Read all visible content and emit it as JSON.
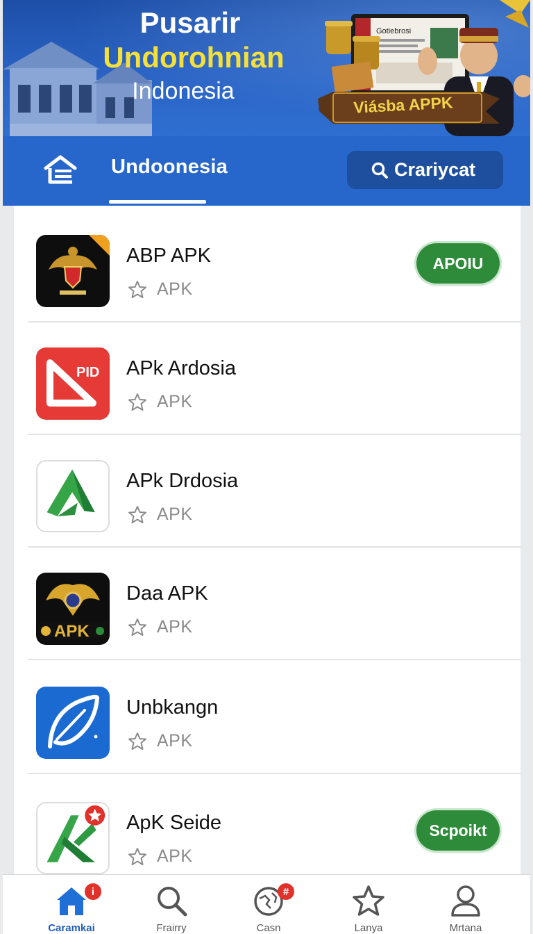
{
  "banner": {
    "title_line1": "Pusarir",
    "title_line2": "Undorohnian",
    "title_line3": "Indonesia",
    "ribbon": "Viásba APPK",
    "screen_text": "Gotiebrosi"
  },
  "nav": {
    "tab_label": "Undoonesia",
    "search_label": "Crariycat"
  },
  "apps": [
    {
      "name": "ABP APK",
      "meta": "APK",
      "action": "APOIU",
      "icon": "garuda-emblem-icon"
    },
    {
      "name": "APk Ardosia",
      "meta": "APK",
      "action": "",
      "icon": "red-pid-triangle-icon",
      "icon_text": "PID"
    },
    {
      "name": "APk Drdosia",
      "meta": "APK",
      "action": "",
      "icon": "green-triangle-icon"
    },
    {
      "name": "Daa APK",
      "meta": "APK",
      "action": "",
      "icon": "gold-garuda-apk-icon",
      "icon_text": "APK"
    },
    {
      "name": "Unbkangn",
      "meta": "APK",
      "action": "",
      "icon": "blue-leaf-icon"
    },
    {
      "name": "ApK Seide",
      "meta": "APK",
      "action": "Scpoikt",
      "icon": "green-x-star-icon"
    }
  ],
  "bottom_nav": [
    {
      "label": "Caramkai",
      "icon": "home-icon",
      "badge": "i",
      "active": true
    },
    {
      "label": "Frairry",
      "icon": "search-icon",
      "badge": "",
      "active": false
    },
    {
      "label": "Casn",
      "icon": "globe-icon",
      "badge": "#",
      "active": false
    },
    {
      "label": "Lanya",
      "icon": "star-icon",
      "badge": "",
      "active": false
    },
    {
      "label": "Mrtana",
      "icon": "profile-icon",
      "badge": "",
      "active": false
    }
  ],
  "colors": {
    "primary_blue": "#2767cc",
    "banner_yellow": "#f5e03a",
    "button_green": "#2e8b3a",
    "active_nav": "#1f5fbf"
  }
}
